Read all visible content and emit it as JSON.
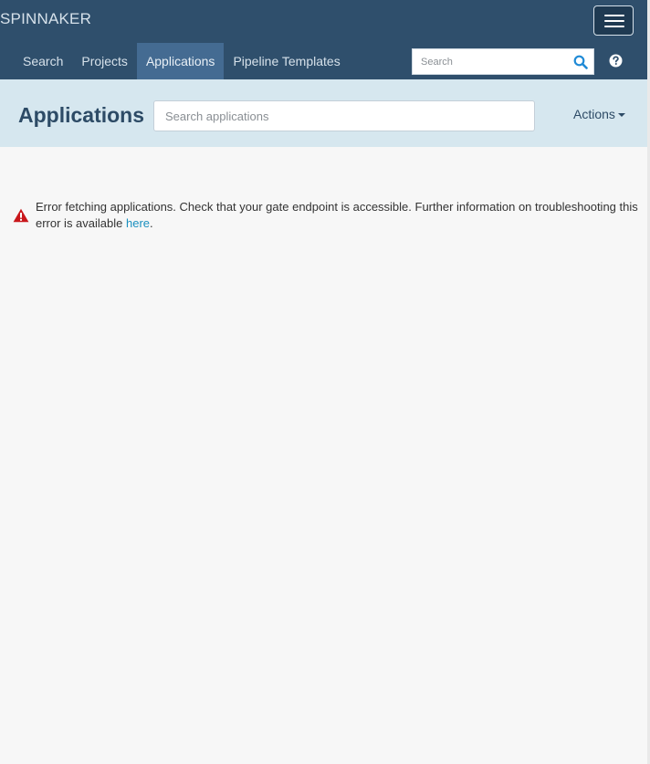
{
  "header": {
    "brand": "SPINNAKER",
    "menu_icon": "hamburger-menu-icon",
    "nav": [
      {
        "label": "Search",
        "active": false
      },
      {
        "label": "Projects",
        "active": false
      },
      {
        "label": "Applications",
        "active": true
      },
      {
        "label": "Pipeline Templates",
        "active": false
      }
    ],
    "search": {
      "placeholder": "Search",
      "icon": "search-icon"
    },
    "help_icon": "help-icon"
  },
  "subheader": {
    "title": "Applications",
    "search_placeholder": "Search applications",
    "actions_label": "Actions"
  },
  "error": {
    "icon": "warning-icon",
    "message": "Error fetching applications. Check that your gate endpoint is accessible. Further information on troubleshooting this error is available ",
    "link_text": "here",
    "suffix": "."
  },
  "colors": {
    "header_bg": "#2f4f6c",
    "nav_active_bg": "#446b92",
    "subheader_bg": "#d6e7ef",
    "title_color": "#2d4b66",
    "link_color": "#1a8fbf",
    "error_icon_color": "#c9171b",
    "page_bg": "#f7f7f7"
  }
}
